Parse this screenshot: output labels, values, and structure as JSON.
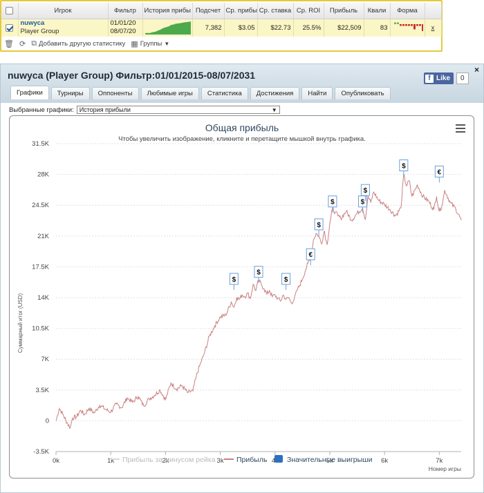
{
  "stats_table": {
    "headers": [
      "Игрок",
      "Фильтр",
      "История прибы",
      "Подсчет",
      "Ср. прибы",
      "Ср. ставка",
      "Ср. ROI",
      "Прибыль",
      "Квали",
      "Форма"
    ],
    "row": {
      "player_name": "nuwyca",
      "player_group": "Player Group",
      "filter_from": "01/01/20",
      "filter_to": "08/07/20",
      "count": "7,382",
      "avg_profit": "$3.05",
      "avg_stake": "$22.73",
      "avg_roi": "25.5%",
      "profit": "$22,509",
      "quali": "83",
      "remove": "x",
      "checked": true
    },
    "profit_history_sparkline": [
      0.1,
      0.12,
      0.1,
      0.15,
      0.18,
      0.22,
      0.3,
      0.35,
      0.45,
      0.5,
      0.55,
      0.6,
      0.7,
      0.72,
      0.78,
      0.8,
      0.82,
      0.85,
      0.88,
      0.9,
      0.92,
      0.95
    ],
    "form_bars": [
      1,
      1,
      -1,
      -1,
      -1,
      -1,
      -1,
      -3,
      -1,
      -1,
      -4
    ]
  },
  "toolbar": {
    "trash_icon": "trash-icon",
    "refresh_icon": "refresh-icon",
    "add_stat_label": "Добавить другую статистику",
    "groups_label": "Группы"
  },
  "panel": {
    "title": "nuwyca (Player Group) Фильтр:01/01/2015-08/07/2031",
    "close": "×",
    "fb_like": "Like",
    "fb_count": "0"
  },
  "tabs": [
    {
      "label": "Графики",
      "active": true
    },
    {
      "label": "Турниры",
      "active": false
    },
    {
      "label": "Оппоненты",
      "active": false
    },
    {
      "label": "Любимые игры",
      "active": false
    },
    {
      "label": "Статистика",
      "active": false
    },
    {
      "label": "Достижения",
      "active": false
    },
    {
      "label": "Найти",
      "active": false
    },
    {
      "label": "Опубликовать",
      "active": false
    }
  ],
  "graph_select": {
    "label": "Выбранные графики:",
    "value": "История прибыли"
  },
  "chart_data": {
    "type": "line",
    "title": "Общая прибыль",
    "subtitle": "Чтобы увеличить изображение, кликните и перетащите мышкой внутрь графика.",
    "ylabel": "Суммарный итог (USD)",
    "xlabel": "Номер игры",
    "xlim": [
      0,
      7400
    ],
    "ylim": [
      -3500,
      31500
    ],
    "y_ticks": [
      -3500,
      0,
      3500,
      7000,
      10500,
      14000,
      17500,
      21000,
      24500,
      28000,
      31500
    ],
    "y_tick_labels": [
      "-3.5K",
      "0",
      "3.5K",
      "7K",
      "10.5K",
      "14K",
      "17.5K",
      "21K",
      "24.5K",
      "28K",
      "31.5K"
    ],
    "x_ticks": [
      0,
      1000,
      2000,
      3000,
      4000,
      5000,
      6000,
      7000
    ],
    "x_tick_labels": [
      "0k",
      "1k",
      "2k",
      "3k",
      "4k",
      "5k",
      "6k",
      "7k"
    ],
    "legend": [
      "Прибыль за минусом рейка",
      "Прибыль",
      "Значительные выигрыши"
    ],
    "legend_colors": [
      "#d9d9d9",
      "#c98080",
      "#2f6fc2"
    ],
    "grid": true,
    "series": [
      {
        "name": "Прибыль",
        "color": "#c98080",
        "x": [
          0,
          60,
          120,
          200,
          260,
          300,
          380,
          450,
          520,
          600,
          700,
          800,
          900,
          1000,
          1100,
          1200,
          1300,
          1400,
          1500,
          1600,
          1700,
          1800,
          1900,
          2000,
          2100,
          2200,
          2300,
          2400,
          2500,
          2560,
          2620,
          2700,
          2800,
          2900,
          3000,
          3100,
          3200,
          3250,
          3300,
          3350,
          3400,
          3450,
          3500,
          3550,
          3600,
          3650,
          3700,
          3750,
          3800,
          3850,
          3900,
          3950,
          4000,
          4050,
          4100,
          4150,
          4200,
          4250,
          4300,
          4350,
          4400,
          4450,
          4500,
          4550,
          4600,
          4650,
          4700,
          4750,
          4800,
          4850,
          4900,
          4950,
          5000,
          5050,
          5100,
          5150,
          5200,
          5300,
          5400,
          5500,
          5600,
          5650,
          5700,
          5750,
          5800,
          5900,
          6000,
          6100,
          6200,
          6300,
          6350,
          6400,
          6450,
          6500,
          6600,
          6700,
          6800,
          6900,
          6950,
          7000,
          7050,
          7100,
          7200,
          7300,
          7400
        ],
        "y": [
          0,
          1400,
          800,
          -200,
          -800,
          300,
          500,
          1200,
          700,
          1400,
          900,
          1800,
          1300,
          1000,
          1900,
          1500,
          2600,
          2100,
          2800,
          1700,
          2500,
          2900,
          3500,
          2400,
          4300,
          3600,
          4000,
          3200,
          3400,
          5000,
          6200,
          7500,
          9600,
          10800,
          11800,
          12000,
          13500,
          12900,
          14000,
          13800,
          14300,
          14100,
          14500,
          13900,
          15500,
          14800,
          16000,
          15500,
          15000,
          14400,
          14800,
          14100,
          14300,
          13900,
          13600,
          14300,
          13800,
          14000,
          13400,
          13800,
          14800,
          15400,
          16100,
          17000,
          17900,
          18400,
          20500,
          21300,
          21000,
          20100,
          21600,
          20000,
          22400,
          24100,
          23700,
          23300,
          23000,
          23800,
          22800,
          23600,
          24200,
          22900,
          25500,
          24800,
          26000,
          25000,
          24600,
          24000,
          23300,
          24200,
          28000,
          26700,
          27300,
          25500,
          26800,
          25500,
          25000,
          24000,
          25500,
          23800,
          24500,
          26200,
          24800,
          24100,
          22800
        ]
      }
    ],
    "big_wins": [
      {
        "x": 3250,
        "y": 15500,
        "symbol": "$"
      },
      {
        "x": 3700,
        "y": 16300,
        "symbol": "$"
      },
      {
        "x": 4200,
        "y": 15500,
        "symbol": "$"
      },
      {
        "x": 4650,
        "y": 18300,
        "symbol": "€"
      },
      {
        "x": 4800,
        "y": 21700,
        "symbol": "$"
      },
      {
        "x": 5050,
        "y": 24300,
        "symbol": "$"
      },
      {
        "x": 5600,
        "y": 24300,
        "symbol": "$"
      },
      {
        "x": 5650,
        "y": 25600,
        "symbol": "$"
      },
      {
        "x": 6350,
        "y": 28400,
        "symbol": "$"
      },
      {
        "x": 7000,
        "y": 27700,
        "symbol": "€"
      }
    ]
  }
}
